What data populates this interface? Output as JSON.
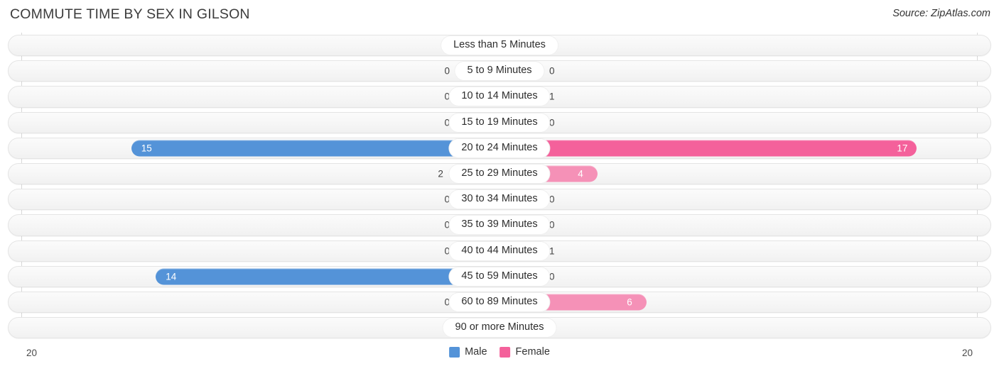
{
  "header": {
    "title": "COMMUTE TIME BY SEX IN GILSON",
    "source": "Source: ZipAtlas.com"
  },
  "axis": {
    "left_max_label": "20",
    "right_max_label": "20"
  },
  "legend": {
    "male_label": "Male",
    "female_label": "Female",
    "male_color": "#5493d8",
    "female_color": "#f4619b"
  },
  "chart_data": {
    "type": "bar",
    "subtype": "diverging-bidirectional-bar",
    "title": "COMMUTE TIME BY SEX IN GILSON",
    "xlabel": "",
    "ylabel": "",
    "xlim": [
      20,
      20
    ],
    "axis_max": 20,
    "grid": true,
    "legend_position": "bottom-center",
    "categories": [
      "Less than 5 Minutes",
      "5 to 9 Minutes",
      "10 to 14 Minutes",
      "15 to 19 Minutes",
      "20 to 24 Minutes",
      "25 to 29 Minutes",
      "30 to 34 Minutes",
      "35 to 39 Minutes",
      "40 to 44 Minutes",
      "45 to 59 Minutes",
      "60 to 89 Minutes",
      "90 or more Minutes"
    ],
    "series": [
      {
        "name": "Male",
        "color": "#5493d8",
        "direction": "left",
        "values": [
          0,
          0,
          0,
          0,
          15,
          2,
          0,
          0,
          0,
          14,
          0,
          0
        ]
      },
      {
        "name": "Female",
        "color": "#f4619b",
        "direction": "right",
        "values": [
          0,
          0,
          1,
          0,
          17,
          4,
          0,
          0,
          1,
          0,
          6,
          0
        ]
      }
    ]
  },
  "rows": [
    {
      "label": "Less than 5 Minutes",
      "male": "0",
      "female": "0"
    },
    {
      "label": "5 to 9 Minutes",
      "male": "0",
      "female": "0"
    },
    {
      "label": "10 to 14 Minutes",
      "male": "0",
      "female": "1"
    },
    {
      "label": "15 to 19 Minutes",
      "male": "0",
      "female": "0"
    },
    {
      "label": "20 to 24 Minutes",
      "male": "15",
      "female": "17"
    },
    {
      "label": "25 to 29 Minutes",
      "male": "2",
      "female": "4"
    },
    {
      "label": "30 to 34 Minutes",
      "male": "0",
      "female": "0"
    },
    {
      "label": "35 to 39 Minutes",
      "male": "0",
      "female": "0"
    },
    {
      "label": "40 to 44 Minutes",
      "male": "0",
      "female": "1"
    },
    {
      "label": "45 to 59 Minutes",
      "male": "14",
      "female": "0"
    },
    {
      "label": "60 to 89 Minutes",
      "male": "0",
      "female": "6"
    },
    {
      "label": "90 or more Minutes",
      "male": "0",
      "female": "0"
    }
  ]
}
